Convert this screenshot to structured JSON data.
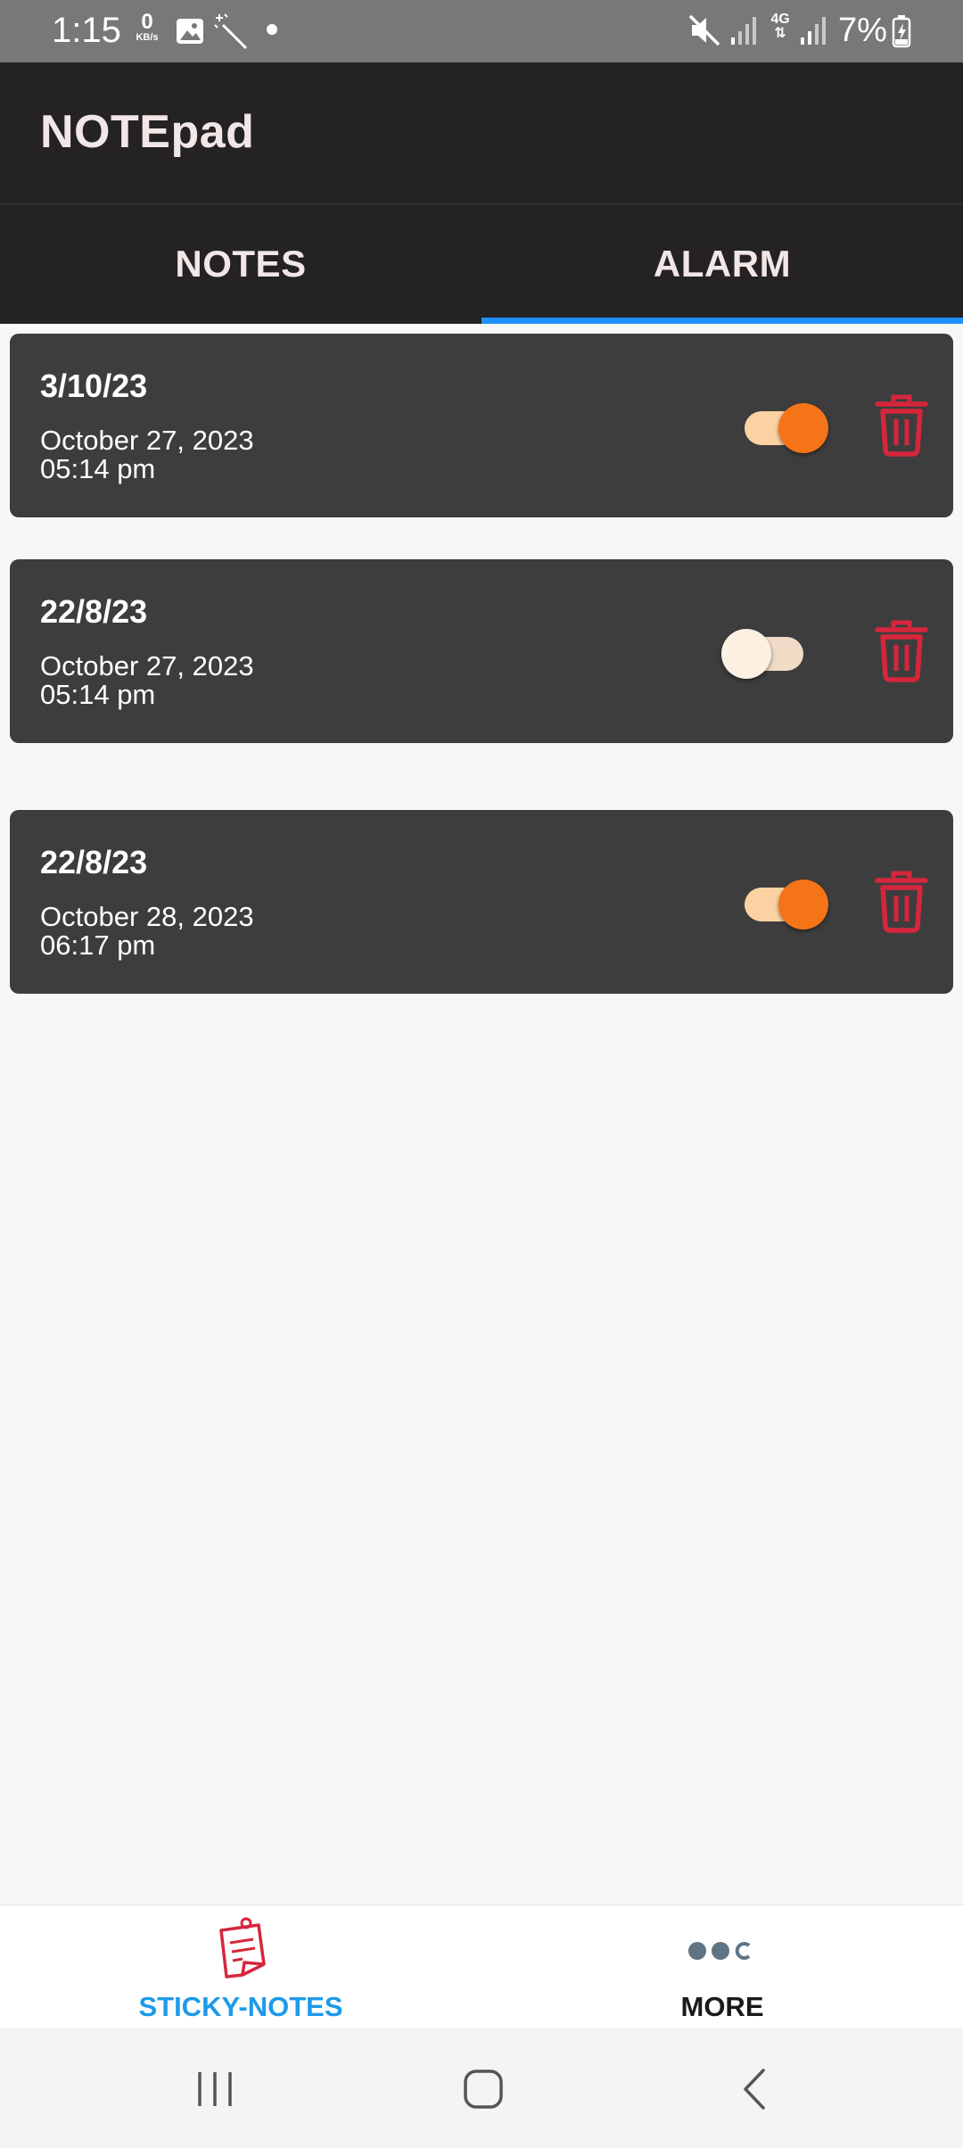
{
  "status_bar": {
    "time": "1:15",
    "net_speed_value": "0",
    "net_speed_unit": "KB/s",
    "network": "4G",
    "battery": "7%"
  },
  "app": {
    "title": "NOTEpad"
  },
  "tabs": [
    {
      "label": "NOTES",
      "active": false
    },
    {
      "label": "ALARM",
      "active": true
    }
  ],
  "alarms": [
    {
      "title": "3/10/23",
      "date": "October 27, 2023",
      "time": "05:14 pm",
      "enabled": true
    },
    {
      "title": "22/8/23",
      "date": "October 27, 2023",
      "time": "05:14 pm",
      "enabled": false
    },
    {
      "title": "22/8/23",
      "date": "October 28, 2023",
      "time": "06:17 pm",
      "enabled": true
    }
  ],
  "bottom_nav": [
    {
      "label": "STICKY-NOTES",
      "icon": "sticky-note-icon",
      "active": true
    },
    {
      "label": "MORE",
      "icon": "more-dots-icon",
      "active": false
    }
  ],
  "system_nav": [
    "recent-apps-icon",
    "home-icon",
    "back-icon"
  ],
  "colors": {
    "accent_blue": "#1e90ff",
    "toggle_on": "#f57418",
    "delete_red": "#d6263c",
    "card_bg": "#3e3d3e",
    "appbar_bg": "#242223"
  }
}
